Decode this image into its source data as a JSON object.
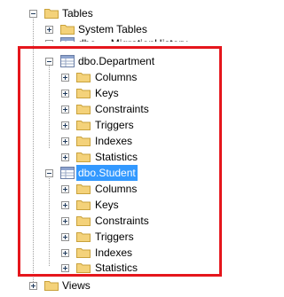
{
  "tree": {
    "tables": {
      "label": "Tables"
    },
    "system_tables": {
      "label": "System Tables"
    },
    "migration_history": {
      "label": "dbo.__MigrationHistory"
    },
    "department": {
      "label": "dbo.Department",
      "children": [
        "Columns",
        "Keys",
        "Constraints",
        "Triggers",
        "Indexes",
        "Statistics"
      ]
    },
    "student": {
      "label": "dbo.Student",
      "children": [
        "Columns",
        "Keys",
        "Constraints",
        "Triggers",
        "Indexes",
        "Statistics"
      ]
    },
    "views": {
      "label": "Views"
    }
  },
  "colors": {
    "highlight": "#e5161c",
    "selection": "#3399ff",
    "folder": "#f4d27a"
  }
}
